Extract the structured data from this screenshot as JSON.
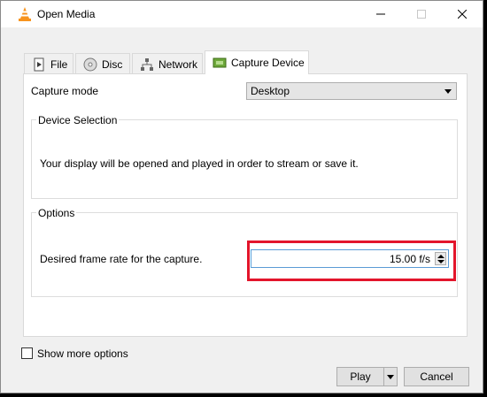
{
  "window": {
    "title": "Open Media",
    "app_icon": "vlc-cone-icon",
    "controls": {
      "minimize": "minimize-icon",
      "maximize": "maximize-icon",
      "close": "close-icon"
    }
  },
  "tabs": [
    {
      "label": "File",
      "icon": "file-icon",
      "active": false
    },
    {
      "label": "Disc",
      "icon": "disc-icon",
      "active": false
    },
    {
      "label": "Network",
      "icon": "network-icon",
      "active": false
    },
    {
      "label": "Capture Device",
      "icon": "capture-device-icon",
      "active": true
    }
  ],
  "capture": {
    "mode_label": "Capture mode",
    "mode_value": "Desktop"
  },
  "device_selection": {
    "title": "Device Selection",
    "text": "Your display will be opened and played in order to stream or save it."
  },
  "options": {
    "title": "Options",
    "framerate_label": "Desired frame rate for the capture.",
    "framerate_value": "15.00 f/s"
  },
  "footer": {
    "show_more_label": "Show more options",
    "show_more_checked": false,
    "play_label": "Play",
    "cancel_label": "Cancel"
  },
  "colors": {
    "highlight": "#e3152b",
    "accent": "#5b9bd5"
  }
}
